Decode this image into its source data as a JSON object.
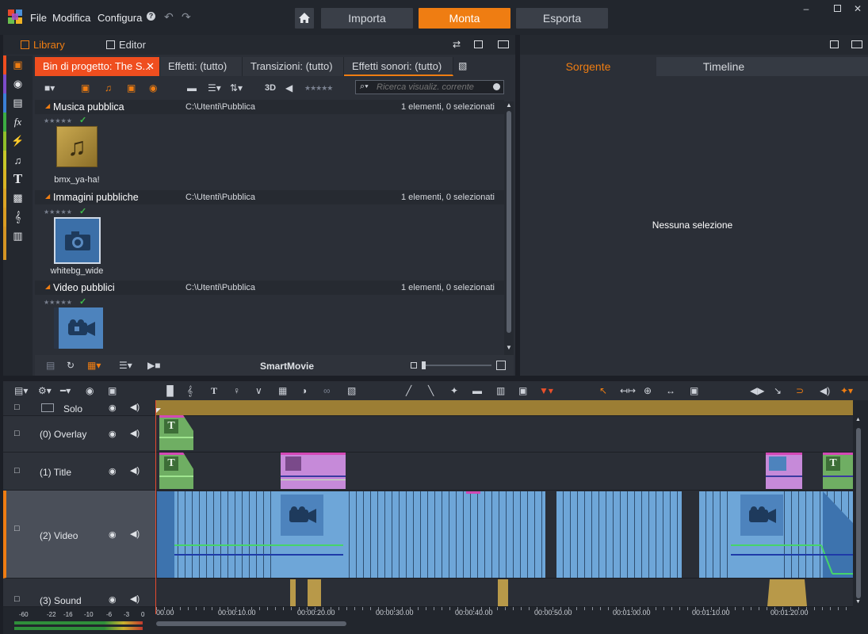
{
  "menu": {
    "file": "File",
    "edit": "Modifica",
    "configure": "Configura"
  },
  "modes": {
    "import": "Importa",
    "edit": "Monta",
    "export": "Esporta",
    "active_color": "#ef7d12"
  },
  "library_panel": {
    "library_tab": "Library",
    "editor_tab": "Editor",
    "tabs": [
      {
        "label": "Bin di progetto: The S...",
        "active": true
      },
      {
        "label": "Effetti: (tutto)",
        "active": false
      },
      {
        "label": "Transizioni: (tutto)",
        "active": false
      },
      {
        "label": "Effetti sonori: (tutto)",
        "active": false
      }
    ],
    "toolbar": {
      "label_3d": "3D",
      "search_placeholder": "Ricerca visualiz. corrente"
    },
    "sections": [
      {
        "title": "Musica pubblica",
        "path": "C:\\Utenti\\Pubblica",
        "count": "1 elementi, 0 selezionati",
        "item_label": "bmx_ya-ha!",
        "icon": "music-note-icon"
      },
      {
        "title": "Immagini pubbliche",
        "path": "C:\\Utenti\\Pubblica",
        "count": "1 elementi, 0 selezionati",
        "item_label": "whitebg_wide",
        "icon": "camera-icon"
      },
      {
        "title": "Video pubblici",
        "path": "C:\\Utenti\\Pubblica",
        "count": "1 elementi, 0 selezionati",
        "item_label": "",
        "icon": "video-camera-icon"
      }
    ],
    "bottom": {
      "smartmovie": "SmartMovie"
    }
  },
  "preview_panel": {
    "tab_source": "Sorgente",
    "tab_timeline": "Timeline",
    "empty_message": "Nessuna selezione"
  },
  "timeline": {
    "tracks": [
      {
        "name": "Solo"
      },
      {
        "name": "(0) Overlay"
      },
      {
        "name": "(1) Title"
      },
      {
        "name": "(2) Video"
      },
      {
        "name": "(3) Sound"
      }
    ],
    "ruler": [
      "00.00",
      "00:00:10.00",
      "00:00:20.00",
      "00:00:30.00",
      "00:00:40.00",
      "00:00:50.00",
      "00:01:00.00",
      "00:01:10.00",
      "00:01:20.00"
    ],
    "meter_scale": [
      "-60",
      "-22",
      "-16",
      "-10",
      "-6",
      "-3",
      "0"
    ]
  },
  "colors": {
    "accent": "#ef7d12",
    "active_tab": "#ef4e1f",
    "video_clip": "#6ea6d8",
    "title_clip": "#6fae63",
    "overlay_clip": "#c68ad9",
    "sound_clip": "#b89949"
  }
}
